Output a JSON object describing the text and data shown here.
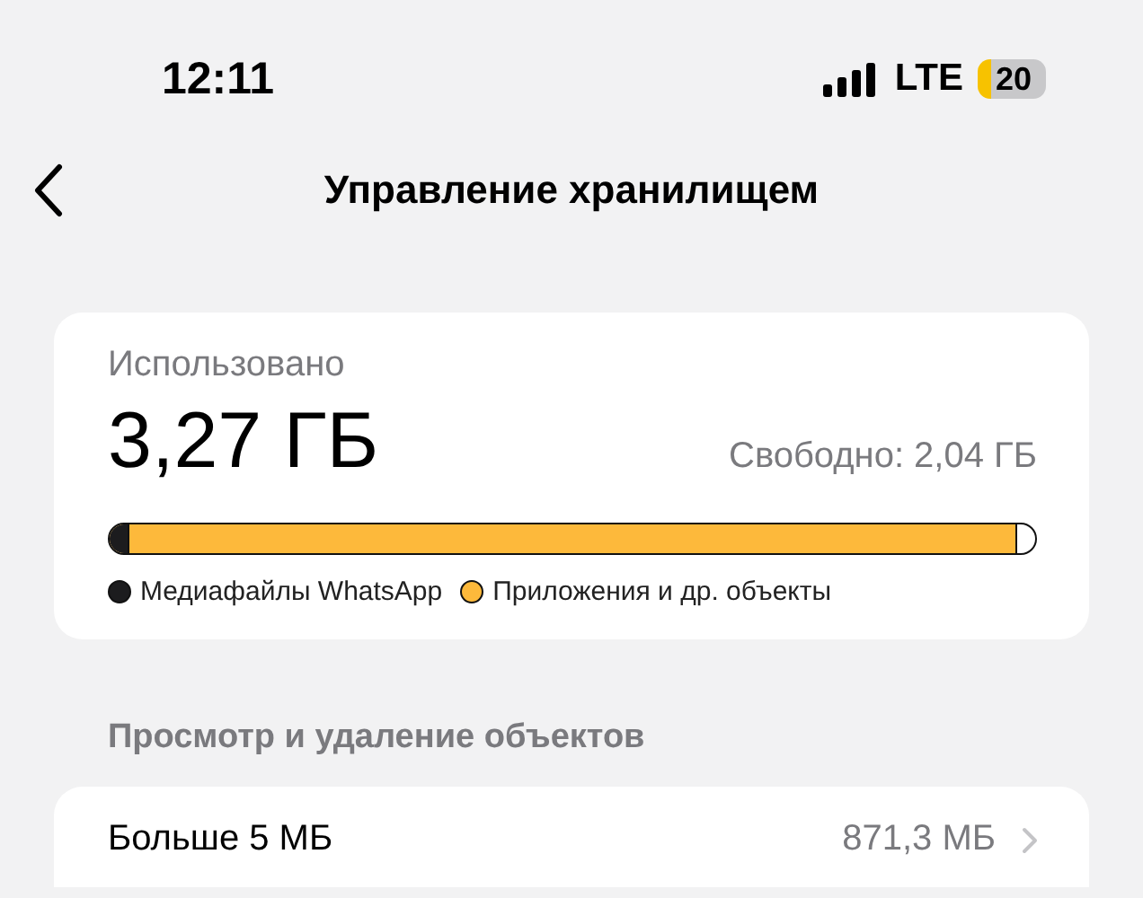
{
  "status_bar": {
    "time": "12:11",
    "network": "LTE",
    "battery": "20"
  },
  "nav": {
    "title": "Управление хранилищем"
  },
  "usage": {
    "label": "Использовано",
    "used": "3,27 ГБ",
    "free": "Свободно: 2,04 ГБ",
    "segments": [
      {
        "name": "Медиафайлы WhatsApp",
        "color": "#1c1c1e",
        "level": 0.022
      },
      {
        "name": "Приложения и др. объекты",
        "color": "#fdb93b",
        "level": 0.98
      }
    ]
  },
  "section": {
    "title": "Просмотр и удаление объектов"
  },
  "rows": [
    {
      "label": "Больше 5 МБ",
      "value": "871,3 МБ"
    }
  ]
}
